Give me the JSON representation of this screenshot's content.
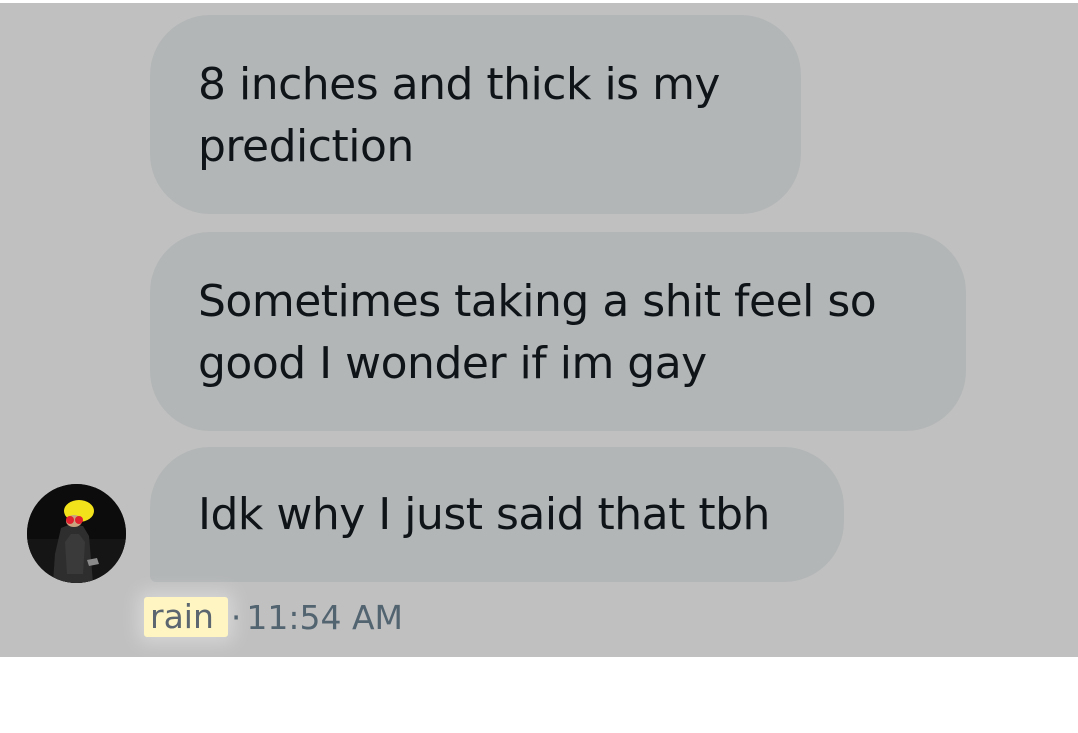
{
  "messages": [
    {
      "text": "8 inches and thick is my prediction"
    },
    {
      "text": "Sometimes taking a shit feel so good I wonder if im gay"
    },
    {
      "text": "Idk why I just said that tbh"
    }
  ],
  "sender": {
    "name": "rain",
    "separator": "·",
    "timestamp": "11:54 AM"
  },
  "colors": {
    "overlay_background": "#c0c0c0",
    "bubble_background": "#b3b6b7",
    "text": "#0f1419",
    "meta_text": "#536471",
    "name_highlight": "#fff5c2"
  },
  "icons": {
    "avatar": "user-avatar-image"
  }
}
